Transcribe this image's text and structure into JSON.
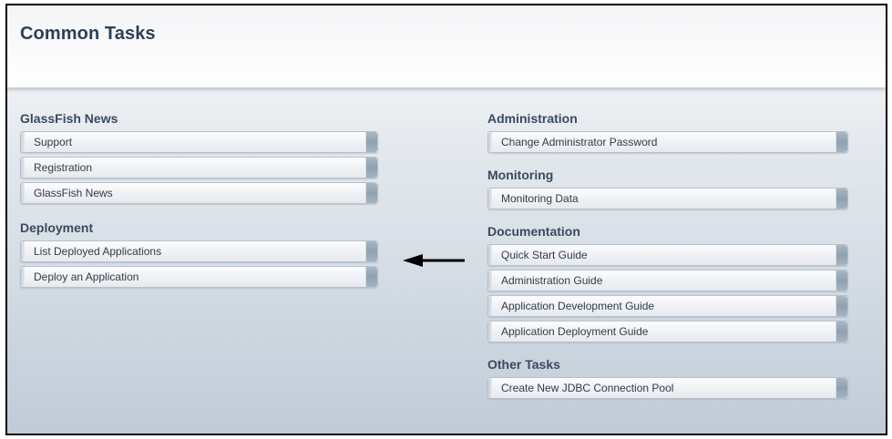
{
  "header": {
    "title": "Common Tasks"
  },
  "left": {
    "news": {
      "title": "GlassFish News",
      "items": [
        "Support",
        "Registration",
        "GlassFish News"
      ]
    },
    "deployment": {
      "title": "Deployment",
      "items": [
        "List Deployed Applications",
        "Deploy an Application"
      ]
    }
  },
  "right": {
    "administration": {
      "title": "Administration",
      "items": [
        "Change Administrator Password"
      ]
    },
    "monitoring": {
      "title": "Monitoring",
      "items": [
        "Monitoring Data"
      ]
    },
    "documentation": {
      "title": "Documentation",
      "items": [
        "Quick Start Guide",
        "Administration Guide",
        "Application Development Guide",
        "Application Deployment Guide"
      ]
    },
    "other": {
      "title": "Other Tasks",
      "items": [
        "Create New JDBC Connection Pool"
      ]
    }
  },
  "colors": {
    "title_text": "#2f3f55",
    "section_text": "#3a4a5e",
    "button_cap": "#8fa1b0",
    "arrow": "#000000"
  },
  "icons": {
    "pointer": "arrow-left-icon"
  }
}
